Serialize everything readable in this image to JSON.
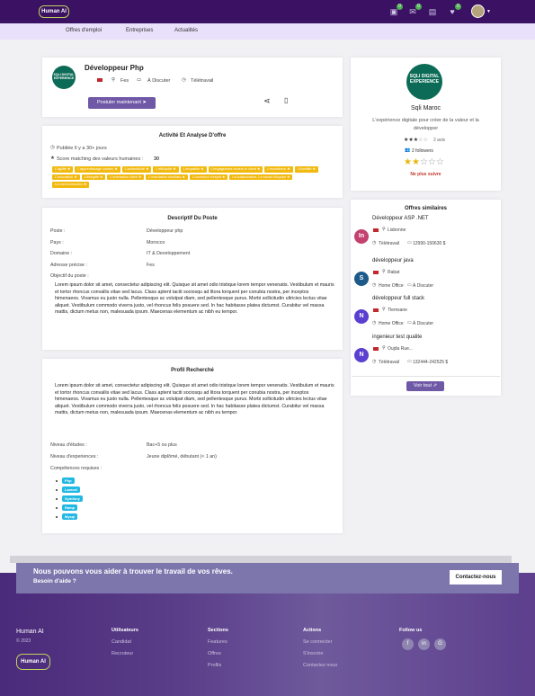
{
  "header": {
    "logo_text": "Human AI",
    "icons": [
      "briefcase-icon",
      "mail-icon",
      "calendar-icon",
      "heart-icon"
    ],
    "badges": [
      "0",
      "0",
      "0",
      "0"
    ]
  },
  "nav": {
    "items": [
      "Offres d'emploi",
      "Entreprises",
      "Actualités"
    ]
  },
  "job": {
    "title": "Développeur Php",
    "company_logo_text": "SQLI DIGITAL EXPERIENCE",
    "location": "Fes",
    "salary": "À Discuter",
    "work_mode": "Télétravail",
    "apply_label": "Postuler maintenant"
  },
  "activity": {
    "title": "Activité Et Analyse D'offre",
    "published": "Publiée Il y a 30+ jours",
    "score_label": "Score matching des valeurs humaines :",
    "score_value": "30",
    "tags": [
      "L'agilité ★",
      "L'apprentissage continu ★",
      "L'authenticité ★",
      "L'efficacité ★",
      "L'empathie ★",
      "L'engagement envers le client ★",
      "L'excellence ★",
      "L'humilité ★",
      "L'innovation ★",
      "L'intégrité ★",
      "L'orientation client ★",
      "L'orientation résultats ★",
      "L'ouverture d'esprit ★",
      "La collaboration, Le travail d'équipe ★",
      "La communication ★"
    ]
  },
  "description": {
    "title": "Descriptif Du Poste",
    "rows": [
      {
        "label": "Poste :",
        "value": "Développeur php"
      },
      {
        "label": "Pays :",
        "value": "Morocco"
      },
      {
        "label": "Domaine :",
        "value": "IT & Developpement"
      },
      {
        "label": "Adresse précise :",
        "value": "Fes"
      },
      {
        "label": "Objectif du poste :",
        "value": ""
      }
    ],
    "text": "Lorem ipsum dolor sit amet, consectetur adipiscing elit. Quisque sit amet odio tristique lorem tempor venenatis. Vestibulum et mauris et tortor rhoncus convallis vitae sed lacus. Class aptent taciti sociosqu ad litora torquent per conubia nostra, per inceptos himenaeos. Vivamus eu justo nulla. Pellentesque ac volutpat diam, sed pellentesque purus. Morbi sollicitudin ultricies lectus vitae aliquet. Vestibulum commodo viverra justo, vel rhoncus felis posuere sed. In hac habitasse platea dictumst. Curabitur vel massa mattis, dictum metus non, malesuada ipsum. Maecenas elementum ac nibh eu tempor."
  },
  "profile": {
    "title": "Profil Recherché",
    "text": "Lorem ipsum dolor sit amet, consectetur adipiscing elit. Quisque sit amet odio tristique lorem tempor venenatis. Vestibulum et mauris et tortor rhoncus convallis vitae sed lacus. Class aptent taciti sociosqu ad litora torquent per conubia nostra, per inceptos himenaeos. Vivamus eu justo nulla. Pellentesque ac volutpat diam, sed pellentesque purus. Morbi sollicitudin ultricies lectus vitae aliquet. Vestibulum commodo viverra justo, vel rhoncus felis posuere sed. In hac habitasse platea dictumst. Curabitur vel massa mattis, dictum metus non, malesuada ipsum. Maecenas elementum ac nibh eu tempor.",
    "rows": [
      {
        "label": "Niveau d'études :",
        "value": "Bac+5 ou plus"
      },
      {
        "label": "Niveau d'experiences :",
        "value": "Jeune diplômé, débutant (< 1 an)"
      }
    ],
    "skills_label": "Compétences requises :",
    "skills": [
      "Php",
      "Laravel",
      "Symfony",
      "Ramp",
      "Mysql"
    ]
  },
  "company": {
    "logo_text": "SQLI DIGITAL EXPERIENCE",
    "name": "Sqli Maroc",
    "tagline": "L'expérience digitale pour créer de la valeur et la développer",
    "reviews": "2 avis",
    "followers": "2 followers",
    "rating_stars": 3,
    "user_rating": 2,
    "follow_status": "Ne plus suivre"
  },
  "similar": {
    "title": "Offres similaires",
    "items": [
      {
        "title": "Développeur ASP .NET",
        "location": "Lisbonne",
        "mode": "Télétravail",
        "salary": "12990-150630 $",
        "logo": "In",
        "color": "#c2416f"
      },
      {
        "title": "développeur java",
        "location": "Rabat",
        "mode": "Home Office",
        "salary": "À Discuter",
        "logo": "S",
        "color": "#1d5a8a"
      },
      {
        "title": "développeur full stack",
        "location": "Tlemsane",
        "mode": "Home Office",
        "salary": "À Discuter",
        "logo": "N",
        "color": "#5b3fd0"
      },
      {
        "title": "ingenieur test qualite",
        "location": "Oujda Rue...",
        "mode": "Télétravail",
        "salary": "132444-242525 $",
        "logo": "N",
        "color": "#5b3fd0"
      }
    ],
    "see_all": "Voir tout"
  },
  "banner": {
    "title": "Nous pouvons vous aider à trouver le travail de vos rêves.",
    "subtitle": "Besoin d'aide ?",
    "button": "Contactez-nous"
  },
  "footer": {
    "brand": "Human AI",
    "copyright": "© 2023",
    "logo_text": "Human AI",
    "columns": [
      {
        "title": "Utilisateurs",
        "links": [
          "Candidat",
          "Recruteur"
        ]
      },
      {
        "title": "Sections",
        "links": [
          "Features",
          "Offres",
          "Profils"
        ]
      },
      {
        "title": "Actions",
        "links": [
          "Se connecter",
          "S'inscrire",
          "Contactez nous"
        ]
      },
      {
        "title": "Follow us",
        "links": []
      }
    ],
    "social_icons": [
      "facebook-icon",
      "linkedin-icon",
      "google-icon"
    ]
  }
}
